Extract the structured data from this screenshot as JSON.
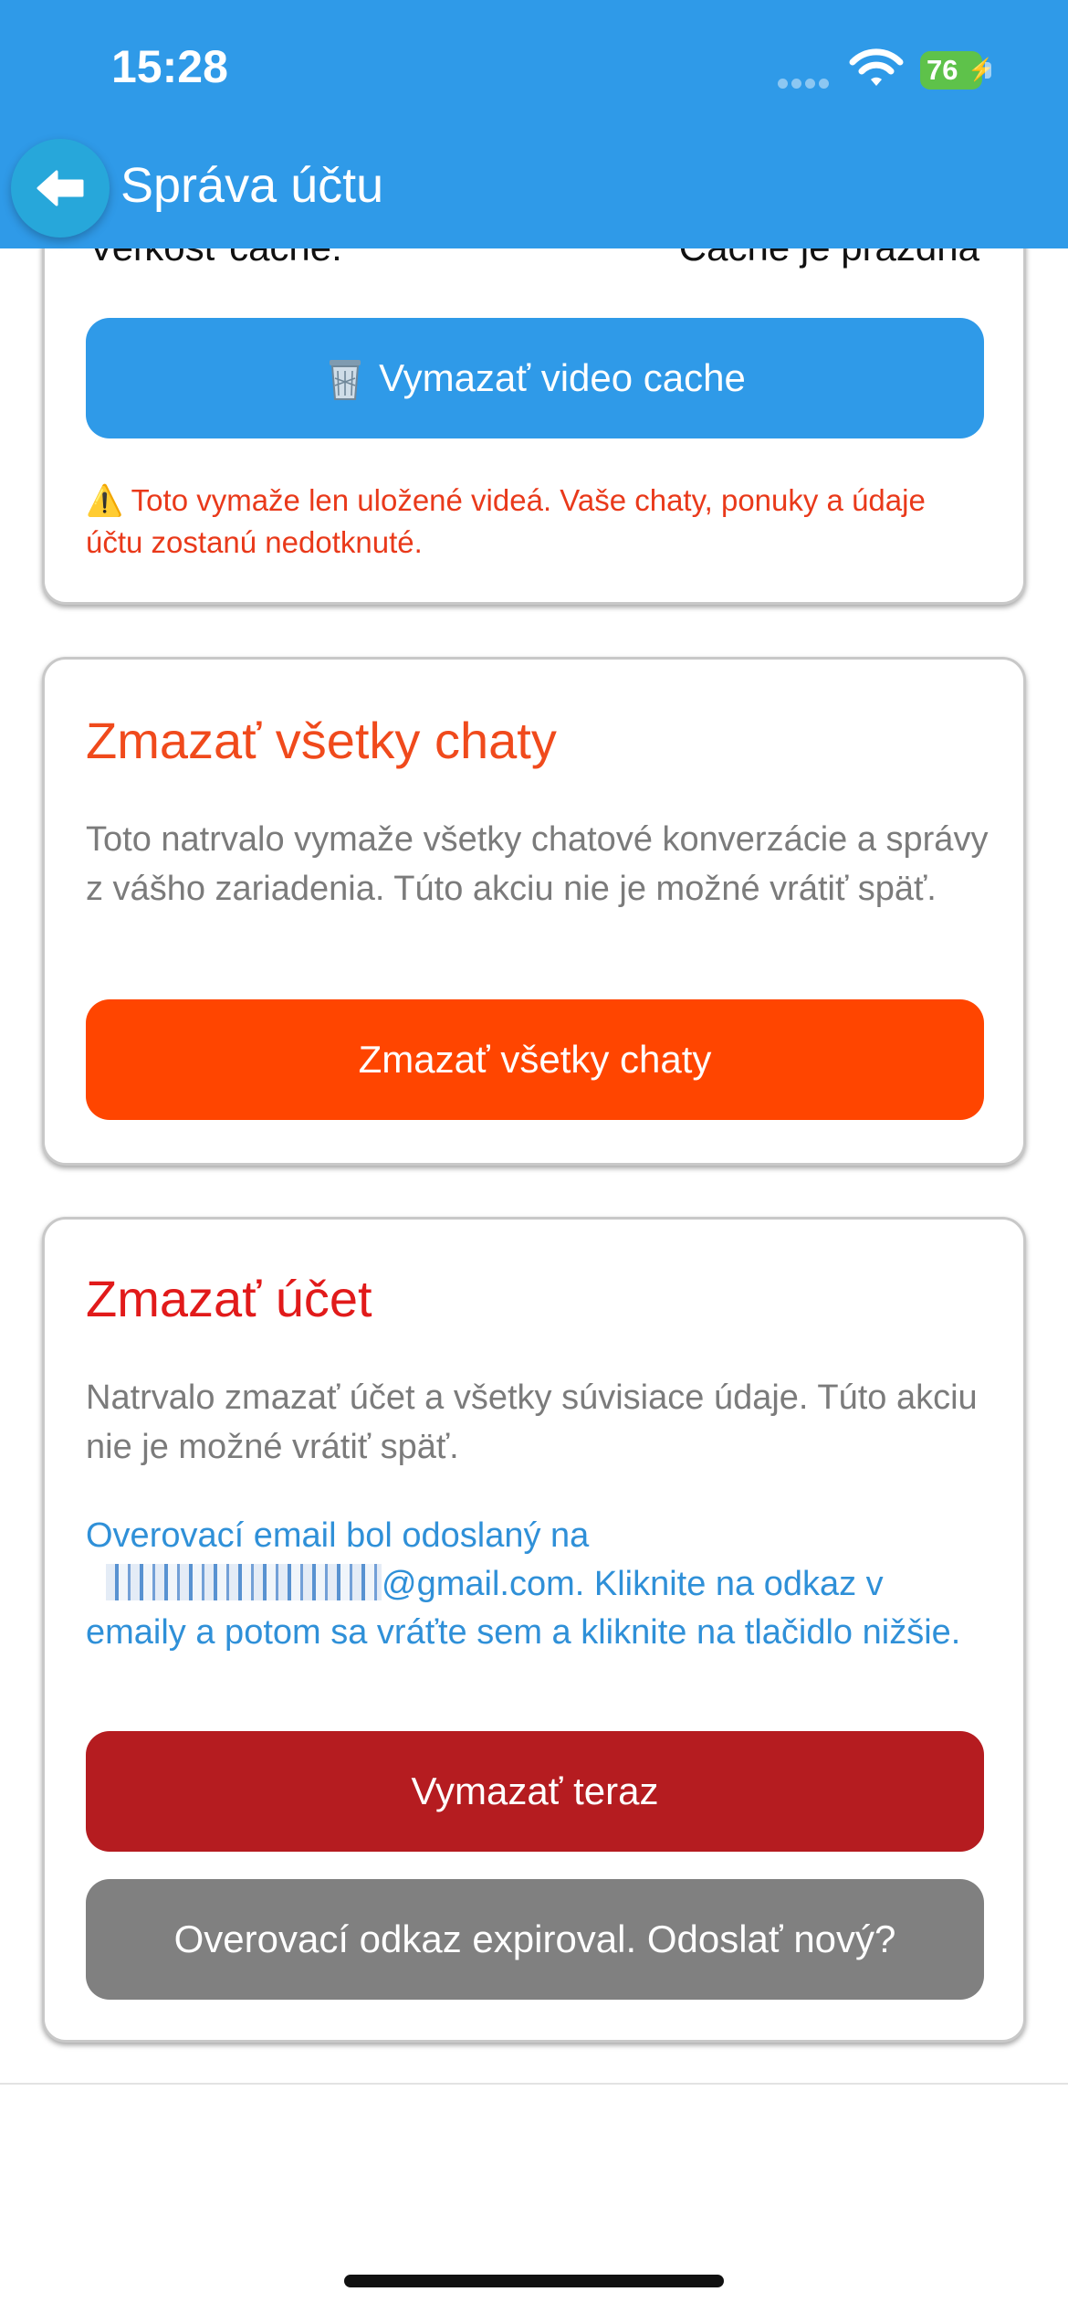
{
  "status_bar": {
    "time": "15:28",
    "battery": "76"
  },
  "header": {
    "title": "Správa účtu",
    "back_icon": "arrow-left-icon"
  },
  "cache_card": {
    "size_label": "Veľkosť cache:",
    "size_value": "Cache je prázdna",
    "clear_button": "Vymazať video cache",
    "clear_icon": "trash-icon",
    "warning_icon": "⚠️",
    "warning_text": "Toto vymaže len uložené videá. Vaše chaty, ponuky a údaje účtu zostanú nedotknuté."
  },
  "chats_card": {
    "title": "Zmazať všetky chaty",
    "description": "Toto natrvalo vymaže všetky chatové konverzácie a správy z vášho zariadenia. Túto akciu nie je možné vrátiť späť.",
    "button": "Zmazať všetky chaty"
  },
  "account_card": {
    "title": "Zmazať účet",
    "description": "Natrvalo zmazať účet a všetky súvisiace údaje. Túto akciu nie je možné vrátiť späť.",
    "verification_prefix": "Overovací email bol odoslaný na",
    "verification_suffix": "@gmail.com. Kliknite na odkaz v emaily a potom sa vráťte sem a kliknite na tlačidlo nižšie.",
    "delete_button": "Vymazať teraz",
    "resend_button": "Overovací odkaz expiroval. Odoslať nový?"
  },
  "colors": {
    "header": "#2f9ae8",
    "cache_button": "#2f9ae8",
    "chats_button": "#ff4500",
    "chats_title": "#f04a1c",
    "account_title": "#e11a1a",
    "delete_button": "#b51c20",
    "resend_button": "#808080",
    "warning_text": "#e9391a",
    "info_text": "#2f90d8"
  }
}
